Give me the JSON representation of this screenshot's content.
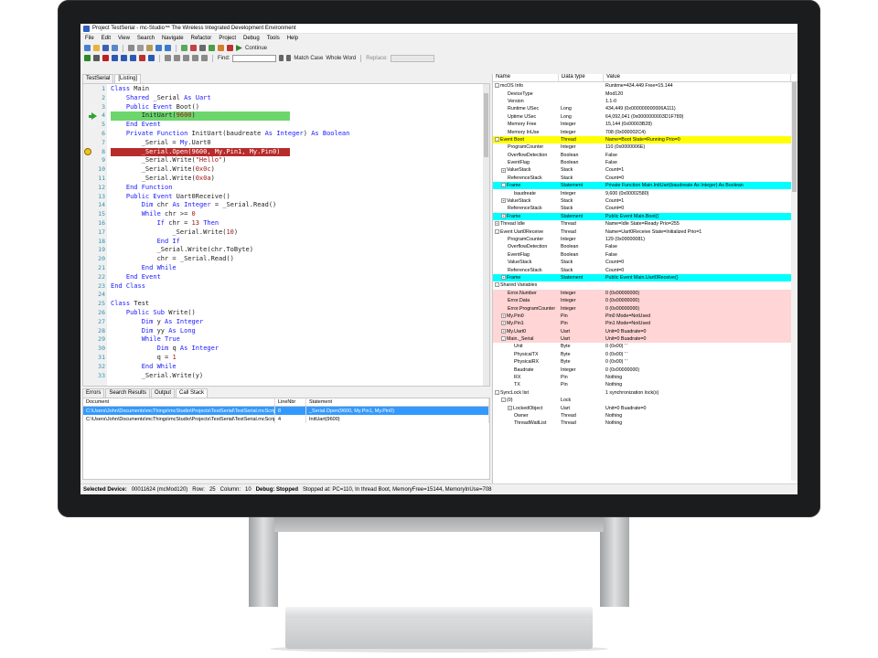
{
  "window": {
    "title": "Project TestSerial - mc-Studio™ The Wireless Integrated Development Environment"
  },
  "menu": [
    "File",
    "Edit",
    "View",
    "Search",
    "Navigate",
    "Refactor",
    "Project",
    "Debug",
    "Tools",
    "Help"
  ],
  "toolbar": {
    "continue_label": "Continue",
    "find_label": "Find:",
    "match_case": "Match Case",
    "whole_word": "Whole Word",
    "replace_label": "Replace:"
  },
  "editor_tabs": [
    {
      "label": "TestSerial",
      "active": false
    },
    {
      "label": "[Listing]",
      "active": true
    }
  ],
  "code_lines": [
    {
      "n": "1",
      "html": "<span class='kw'>Class</span> Main"
    },
    {
      "n": "2",
      "html": "    <span class='kw'>Shared</span> _Serial <span class='kw'>As</span> <span class='ty'>Uart</span>"
    },
    {
      "n": "3",
      "html": "    <span class='kw'>Public Event</span> Boot()"
    },
    {
      "n": "4",
      "html": "        InitUart(<span class='num'>9600</span>)",
      "hl": "green",
      "marker": "arrow"
    },
    {
      "n": "5",
      "html": "    <span class='kw'>End Event</span>"
    },
    {
      "n": "6",
      "html": "    <span class='kw'>Private Function</span> InitUart(baudreate <span class='kw'>As</span> <span class='ty'>Integer</span>) <span class='kw'>As</span> <span class='ty'>Boolean</span>"
    },
    {
      "n": "7",
      "html": "        _Serial = <span class='kw'>My</span>.Uart0"
    },
    {
      "n": "8",
      "html": "        _Serial.Open(9600, My.Pin1, My.Pin0)",
      "hl": "red",
      "marker": "bp"
    },
    {
      "n": "9",
      "html": "        _Serial.Write(<span class='str'>\"Hello\"</span>)"
    },
    {
      "n": "10",
      "html": "        _Serial.Write(<span class='num'>0x0c</span>)"
    },
    {
      "n": "11",
      "html": "        _Serial.Write(<span class='num'>0x0a</span>)"
    },
    {
      "n": "12",
      "html": "    <span class='kw'>End Function</span>"
    },
    {
      "n": "13",
      "html": "    <span class='kw'>Public Event</span> Uart0Receive()"
    },
    {
      "n": "14",
      "html": "        <span class='kw'>Dim</span> chr <span class='kw'>As</span> <span class='ty'>Integer</span> = _Serial.Read()"
    },
    {
      "n": "15",
      "html": "        <span class='kw'>While</span> chr >= <span class='num'>0</span>"
    },
    {
      "n": "16",
      "html": "            <span class='kw'>If</span> chr = <span class='num'>13</span> <span class='kw'>Then</span>"
    },
    {
      "n": "17",
      "html": "                _Serial.Write(<span class='num'>10</span>)"
    },
    {
      "n": "18",
      "html": "            <span class='kw'>End If</span>"
    },
    {
      "n": "19",
      "html": "            _Serial.Write(chr.ToByte)"
    },
    {
      "n": "20",
      "html": "            chr = _Serial.Read()"
    },
    {
      "n": "21",
      "html": "        <span class='kw'>End While</span>"
    },
    {
      "n": "22",
      "html": "    <span class='kw'>End Event</span>"
    },
    {
      "n": "23",
      "html": "<span class='kw'>End Class</span>"
    },
    {
      "n": "24",
      "html": ""
    },
    {
      "n": "25",
      "html": "<span class='kw'>Class</span> Test"
    },
    {
      "n": "26",
      "html": "    <span class='kw'>Public Sub</span> Write()"
    },
    {
      "n": "27",
      "html": "        <span class='kw'>Dim</span> y <span class='kw'>As</span> <span class='ty'>Integer</span>"
    },
    {
      "n": "28",
      "html": "        <span class='kw'>Dim</span> yy <span class='kw'>As</span> <span class='ty'>Long</span>"
    },
    {
      "n": "29",
      "html": "        <span class='kw'>While True</span>"
    },
    {
      "n": "30",
      "html": "            <span class='kw'>Dim</span> q <span class='kw'>As</span> <span class='ty'>Integer</span>"
    },
    {
      "n": "31",
      "html": "            q = <span class='num'>1</span>"
    },
    {
      "n": "32",
      "html": "        <span class='kw'>End While</span>"
    },
    {
      "n": "33",
      "html": "        _Serial.Write(y)"
    }
  ],
  "bottom_tabs": [
    {
      "label": "Errors",
      "active": false
    },
    {
      "label": "Search Results",
      "active": false
    },
    {
      "label": "Output",
      "active": false
    },
    {
      "label": "Call Stack",
      "active": true
    }
  ],
  "callstack": {
    "columns": [
      "Document",
      "LineNbr",
      "Statement"
    ],
    "rows": [
      {
        "doc": "C:\\Users\\John\\Documents\\mcThings\\mcStudio\\Projects\\TestSerial\\TestSerial.mcScript",
        "line": "8",
        "stmt": "_Serial.Open(9600, My.Pin1, My.Pin0)",
        "selected": true
      },
      {
        "doc": "C:\\Users\\John\\Documents\\mcThings\\mcStudio\\Projects\\TestSerial\\TestSerial.mcScript",
        "line": "4",
        "stmt": "InitUart(9600)",
        "selected": false
      }
    ]
  },
  "status": {
    "device_label": "Selected Device:",
    "device_value": "00011624 (mcMod120)",
    "row_label": "Row:",
    "row_value": "25",
    "column_label": "Column:",
    "column_value": "10",
    "debug_state": "Debug: Stopped",
    "stopped_at": "Stopped at: PC=110,  In thread Boot,  MemoryFree=15144,  MemoryInUse=708"
  },
  "watch": {
    "columns": [
      "Name",
      "Data type",
      "Value"
    ],
    "colors": {
      "yellow": "#ffff00",
      "cyan": "#00ffff",
      "pink": "#ffd5d5"
    },
    "rows": [
      {
        "name": "mcOS Info",
        "type": "",
        "value": "Runtime=434.449   Free=15.144",
        "d": 0,
        "exp": "-"
      },
      {
        "name": "DeviceType",
        "type": "",
        "value": "Mod120",
        "d": 1
      },
      {
        "name": "Version",
        "type": "",
        "value": "1.1-0",
        "d": 1
      },
      {
        "name": "Runtime USec",
        "type": "Long",
        "value": "434,449 (0x000000000006A111)",
        "d": 1
      },
      {
        "name": "Uptime USec",
        "type": "Long",
        "value": "64,092,041 (0x0000000003D1F789)",
        "d": 1
      },
      {
        "name": "Memory Free",
        "type": "Integer",
        "value": "15,144 (0x00003B28)",
        "d": 1
      },
      {
        "name": "Memory InUse",
        "type": "Integer",
        "value": "708 (0x000002C4)",
        "d": 1
      },
      {
        "name": "Event Boot",
        "type": "Thread",
        "value": "Name=Boot State=Running  Prio=0",
        "d": 0,
        "exp": "-",
        "bg": "yellow"
      },
      {
        "name": "ProgramCounter",
        "type": "Integer",
        "value": "110 (0x0000006E)",
        "d": 1
      },
      {
        "name": "OverflowDetection",
        "type": "Boolean",
        "value": "False",
        "d": 1
      },
      {
        "name": "EventFlag",
        "type": "Boolean",
        "value": "False",
        "d": 1
      },
      {
        "name": "ValueStack",
        "type": "Stack",
        "value": "Count=1",
        "d": 1,
        "exp": "+"
      },
      {
        "name": "ReferenceStack",
        "type": "Stack",
        "value": "Count=0",
        "d": 1
      },
      {
        "name": "Frame",
        "type": "Statement",
        "value": "Private Function Main.InitUart(baudreate As Integer) As Boolean",
        "d": 1,
        "exp": "-",
        "bg": "cyan"
      },
      {
        "name": "baudreate",
        "type": "Integer",
        "value": "9,600 (0x00002580)",
        "d": 2
      },
      {
        "name": "ValueStack",
        "type": "Stack",
        "value": "Count=1",
        "d": 1,
        "exp": "+"
      },
      {
        "name": "ReferenceStack",
        "type": "Stack",
        "value": "Count=0",
        "d": 1
      },
      {
        "name": "Frame",
        "type": "Statement",
        "value": "Public Event Main.Boot()",
        "d": 1,
        "exp": "+",
        "bg": "cyan"
      },
      {
        "name": "Thread Idle",
        "type": "Thread",
        "value": "Name=Idle State=Ready  Prio=255",
        "d": 0,
        "exp": "+"
      },
      {
        "name": "Event Uart0Receive",
        "type": "Thread",
        "value": "Name=Uart0Receive State=Initialized  Prio=1",
        "d": 0,
        "exp": "-"
      },
      {
        "name": "ProgramCounter",
        "type": "Integer",
        "value": "129 (0x00000081)",
        "d": 1
      },
      {
        "name": "OverflowDetection",
        "type": "Boolean",
        "value": "False",
        "d": 1
      },
      {
        "name": "EventFlag",
        "type": "Boolean",
        "value": "False",
        "d": 1
      },
      {
        "name": "ValueStack",
        "type": "Stack",
        "value": "Count=0",
        "d": 1
      },
      {
        "name": "ReferenceStack",
        "type": "Stack",
        "value": "Count=0",
        "d": 1
      },
      {
        "name": "Frame",
        "type": "Statement",
        "value": "Public Event Main.Uart0Receive()",
        "d": 1,
        "exp": "+",
        "bg": "cyan"
      },
      {
        "name": "Shared Variables",
        "type": "",
        "value": "",
        "d": 0,
        "exp": "-"
      },
      {
        "name": "Error.Number",
        "type": "Integer",
        "value": "0 (0x00000000)",
        "d": 1,
        "bg": "pink"
      },
      {
        "name": "Error.Data",
        "type": "Integer",
        "value": "0 (0x00000000)",
        "d": 1,
        "bg": "pink"
      },
      {
        "name": "Error.ProgramCounter",
        "type": "Integer",
        "value": "0 (0x00000000)",
        "d": 1,
        "bg": "pink"
      },
      {
        "name": "My.Pin0",
        "type": "Pin",
        "value": "Pin0 Mode=NotUsed",
        "d": 1,
        "exp": "+",
        "bg": "pink"
      },
      {
        "name": "My.Pin1",
        "type": "Pin",
        "value": "Pin1 Mode=NotUsed",
        "d": 1,
        "exp": "+",
        "bg": "pink"
      },
      {
        "name": "My.Uart0",
        "type": "Uart",
        "value": "Unit=0 Buadrate=0",
        "d": 1,
        "exp": "+",
        "bg": "pink"
      },
      {
        "name": "Main._Serial",
        "type": "Uart",
        "value": "Unit=0 Buadrate=0",
        "d": 1,
        "exp": "-",
        "bg": "pink"
      },
      {
        "name": "Unit",
        "type": "Byte",
        "value": "0 (0x00) ' '",
        "d": 2
      },
      {
        "name": "PhysicalTX",
        "type": "Byte",
        "value": "0 (0x00) ' '",
        "d": 2
      },
      {
        "name": "PhysicalRX",
        "type": "Byte",
        "value": "0 (0x00) ' '",
        "d": 2
      },
      {
        "name": "Baudrate",
        "type": "Integer",
        "value": "0 (0x00000000)",
        "d": 2
      },
      {
        "name": "RX",
        "type": "Pin",
        "value": "Nothing",
        "d": 2
      },
      {
        "name": "TX",
        "type": "Pin",
        "value": "Nothing",
        "d": 2
      },
      {
        "name": "SyncLock list",
        "type": "",
        "value": "1 synchronization lock(s)",
        "d": 0,
        "exp": "-"
      },
      {
        "name": "(0)",
        "type": "Lock",
        "value": "",
        "d": 1,
        "exp": "-"
      },
      {
        "name": "LockedObject",
        "type": "Uart",
        "value": "Unit=0 Buadrate=0",
        "d": 2,
        "exp": "+"
      },
      {
        "name": "Owner",
        "type": "Thread",
        "value": "Nothing",
        "d": 2
      },
      {
        "name": "ThreadWaitList",
        "type": "Thread",
        "value": "Nothing",
        "d": 2
      }
    ]
  }
}
